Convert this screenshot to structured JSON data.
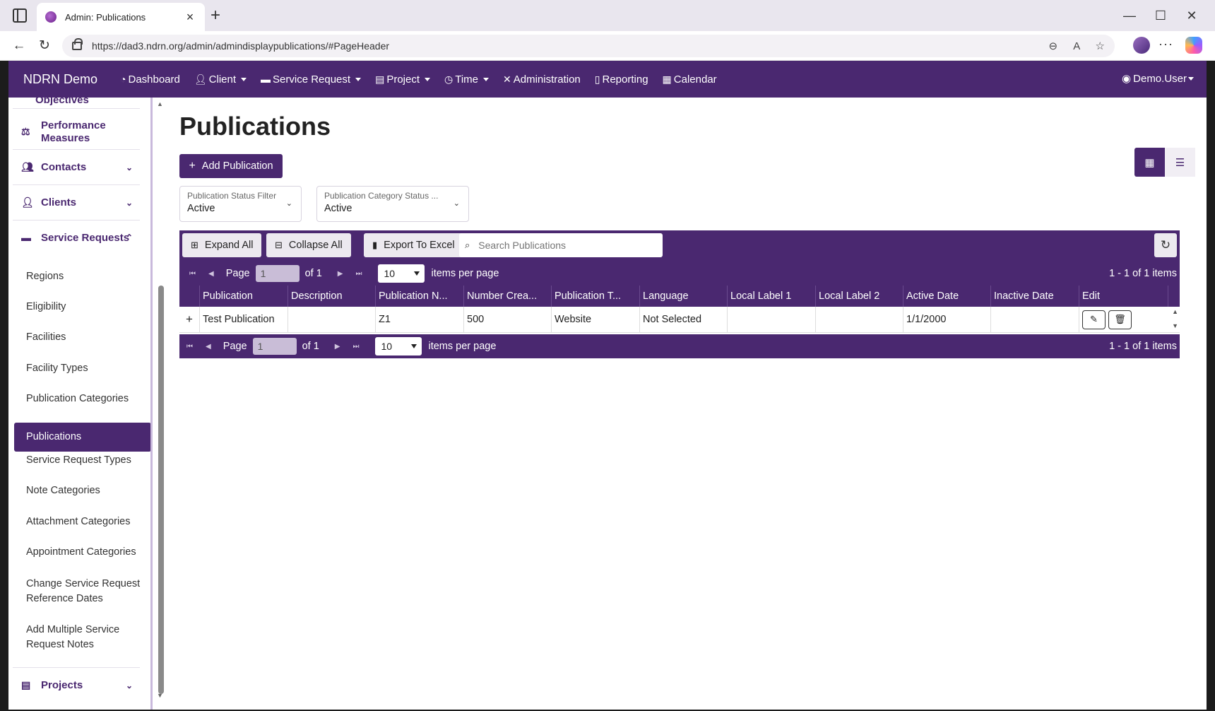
{
  "browser": {
    "tab_title": "Admin: Publications",
    "url": "https://dad3.ndrn.org/admin/admindisplaypublications/#PageHeader"
  },
  "navbar": {
    "brand": "NDRN Demo",
    "items": [
      {
        "label": "Dashboard",
        "icon": "dashboard-icon",
        "dropdown": false
      },
      {
        "label": "Client",
        "icon": "user-icon",
        "dropdown": true
      },
      {
        "label": "Service Request",
        "icon": "briefcase-icon",
        "dropdown": true
      },
      {
        "label": "Project",
        "icon": "clipboard-icon",
        "dropdown": true
      },
      {
        "label": "Time",
        "icon": "clock-icon",
        "dropdown": true
      },
      {
        "label": "Administration",
        "icon": "tools-icon",
        "dropdown": false
      },
      {
        "label": "Reporting",
        "icon": "file-icon",
        "dropdown": false
      },
      {
        "label": "Calendar",
        "icon": "calendar-icon",
        "dropdown": false
      }
    ],
    "user": "Demo.User"
  },
  "sidebar": {
    "objectives_label": "Objectives",
    "performance_label_1": "Performance",
    "performance_label_2": "Measures",
    "contacts_label": "Contacts",
    "clients_label": "Clients",
    "service_requests_label": "Service Requests",
    "items": [
      "Regions",
      "Eligibility",
      "Facilities",
      "Facility Types",
      "Publication Categories",
      "Publications",
      "Service Request Types",
      "Note Categories",
      "Attachment Categories",
      "Appointment Categories"
    ],
    "change_ref_1": "Change Service Request",
    "change_ref_2": "Reference Dates",
    "add_notes_1": "Add Multiple Service",
    "add_notes_2": "Request Notes",
    "projects_label": "Projects",
    "active_item": "Publications"
  },
  "main": {
    "title": "Publications",
    "add_button": "Add Publication",
    "filters": {
      "status_label": "Publication Status Filter",
      "status_value": "Active",
      "category_label": "Publication Category Status ...",
      "category_value": "Active"
    },
    "toolbar": {
      "expand_all": "Expand All",
      "collapse_all": "Collapse All",
      "export": "Export To Excel",
      "search_placeholder": "Search Publications"
    },
    "pager": {
      "page_label": "Page",
      "page_value": "1",
      "of_label": "of 1",
      "per_page_value": "10",
      "per_page_label": "items per page",
      "info": "1 - 1 of 1 items"
    },
    "columns": [
      "Publication",
      "Description",
      "Publication N...",
      "Number Crea...",
      "Publication T...",
      "Language",
      "Local Label 1",
      "Local Label 2",
      "Active Date",
      "Inactive Date",
      "Edit"
    ],
    "rows": [
      {
        "expand": "+",
        "publication": "Test Publication",
        "description": "",
        "number": "Z1",
        "created": "500",
        "type": "Website",
        "language": "Not Selected",
        "label1": "",
        "label2": "",
        "active_date": "1/1/2000",
        "inactive_date": ""
      }
    ]
  },
  "colors": {
    "primary": "#4a2870",
    "toolbar_button": "#ece9ef"
  }
}
